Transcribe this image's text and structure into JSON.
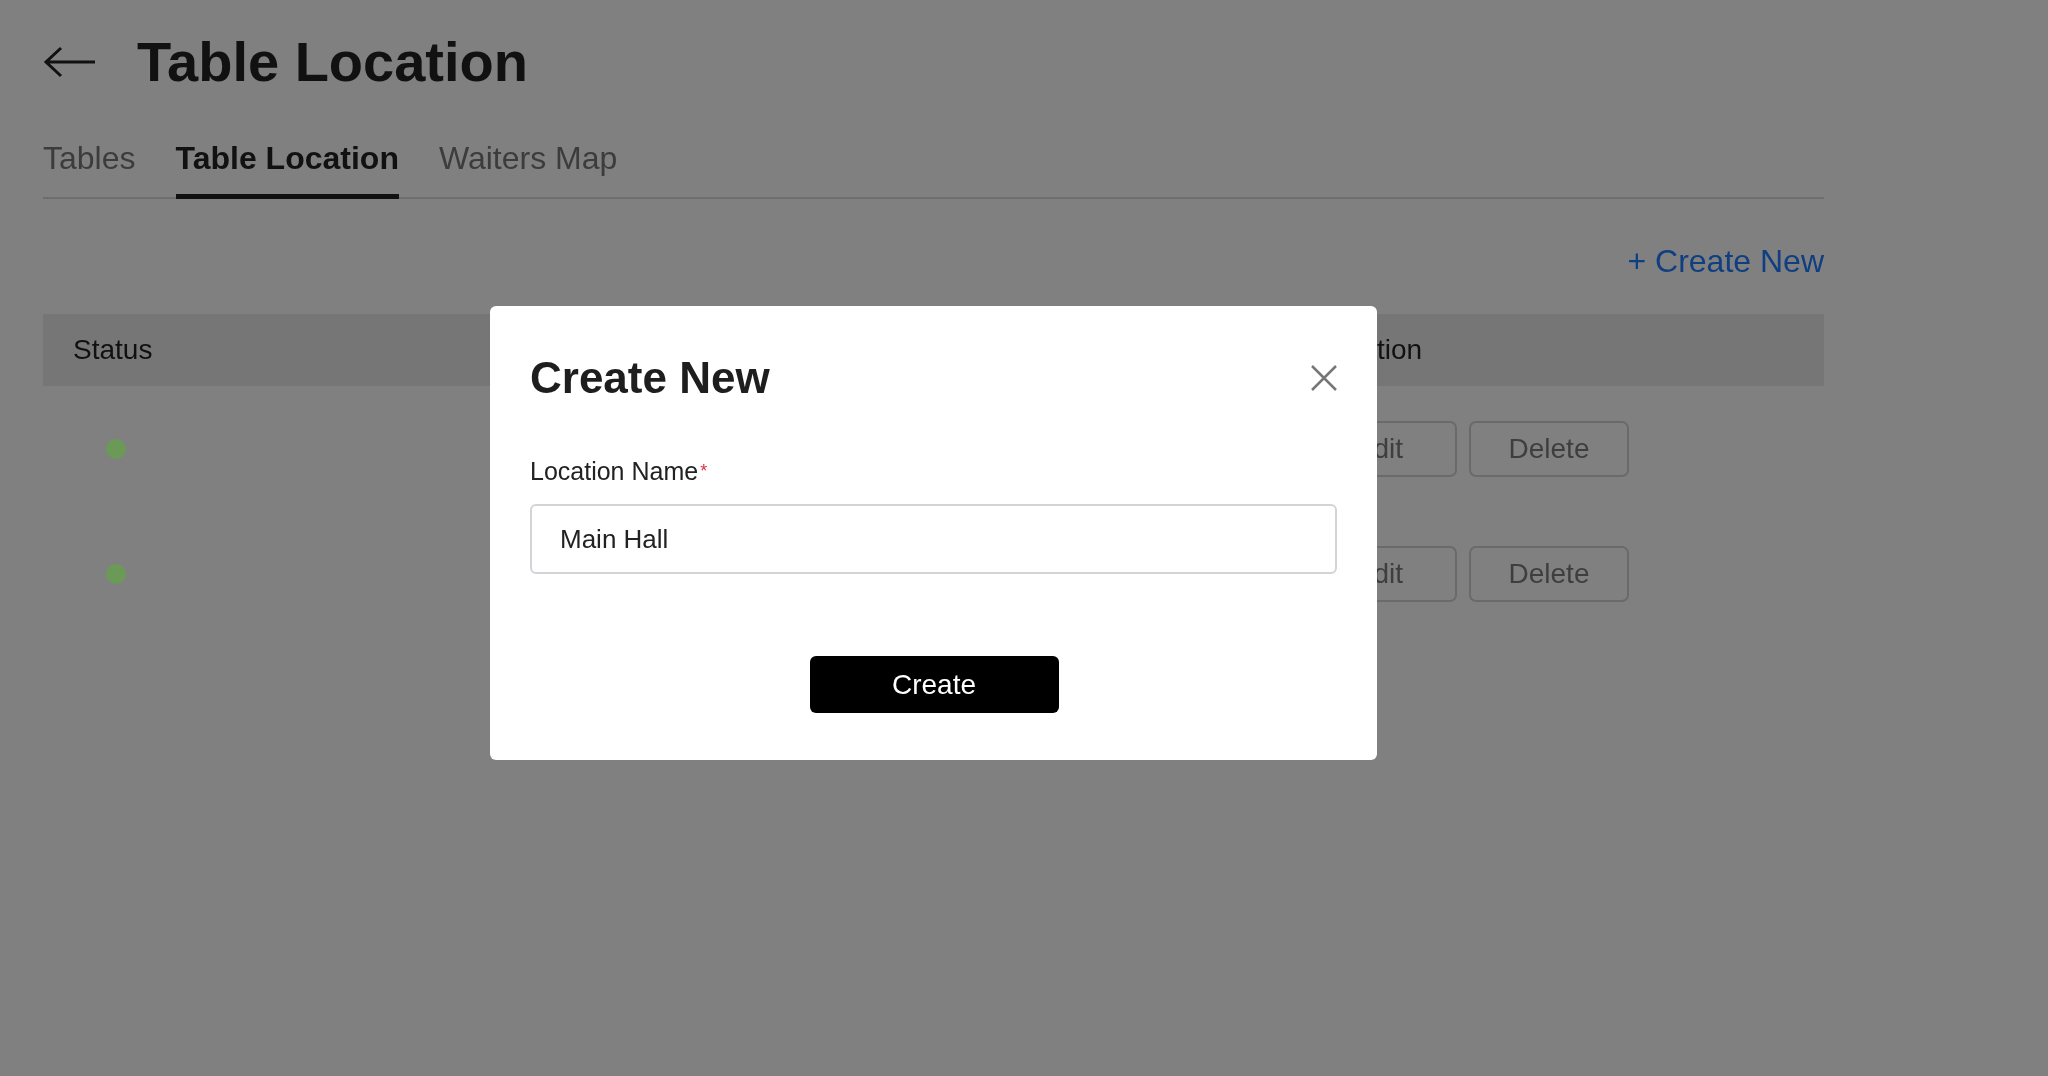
{
  "page": {
    "title": "Table Location"
  },
  "tabs": [
    {
      "label": "Tables",
      "selected": false
    },
    {
      "label": "Table Location",
      "selected": true
    },
    {
      "label": "Waiters Map",
      "selected": false
    }
  ],
  "create_link": "+ Create New",
  "table": {
    "columns": [
      "Status",
      "tion"
    ],
    "rows": [
      {
        "color": "#6a9a56",
        "buttons": [
          "dit",
          "Delete"
        ]
      },
      {
        "color": "#6a9a56",
        "buttons": [
          "dit",
          "Delete"
        ]
      }
    ]
  },
  "modal": {
    "title": "Create New",
    "field": {
      "label": "Location Name",
      "required_mark": "*",
      "value": "Main Hall"
    },
    "button": "Create"
  }
}
